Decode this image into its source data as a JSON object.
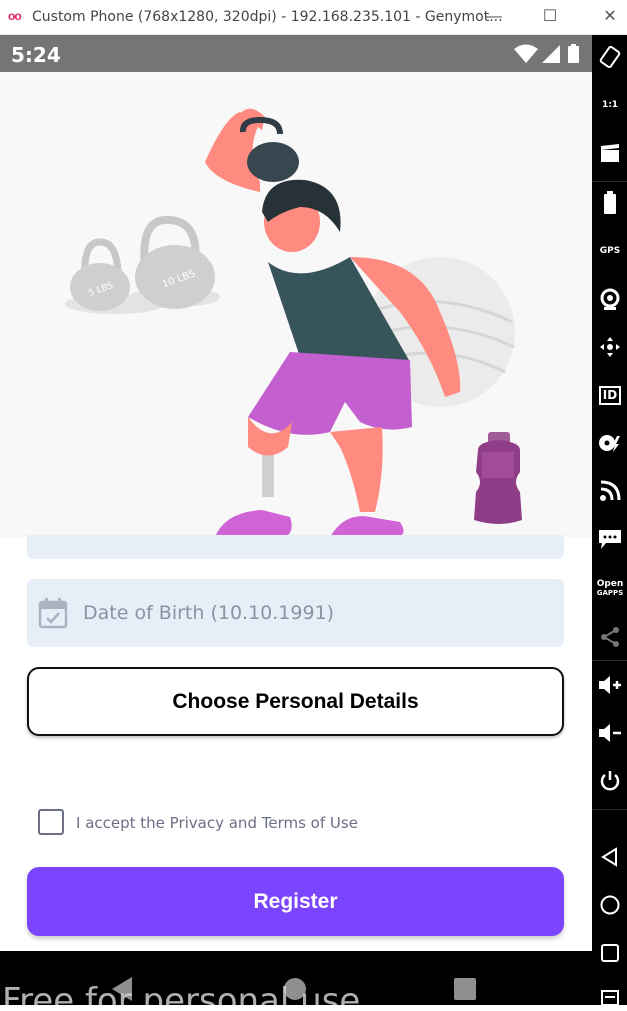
{
  "window": {
    "logo": "oo",
    "title": "Custom Phone (768x1280, 320dpi) - 192.168.235.101 - Genymot...",
    "minimize": "—",
    "maximize": "☐",
    "close": "✕"
  },
  "status_bar": {
    "time": "5:24"
  },
  "form": {
    "dob_placeholder": "Date of Birth (10.10.1991)",
    "personal_details_label": "Choose Personal Details",
    "accept_label": "I accept the Privacy and Terms of Use",
    "register_label": "Register",
    "accent_color": "#7b45ff",
    "field_bg": "#e7eef8"
  },
  "illustration": {
    "kettlebell_small": "5 LBS",
    "kettlebell_large": "10 LBS"
  },
  "watermark": "Free for personal use",
  "side_toolbar": {
    "scale_label": "1:1",
    "gps_label": "GPS",
    "id_label": "ID",
    "gapps_label_1": "Open",
    "gapps_label_2": "GAPPS"
  }
}
